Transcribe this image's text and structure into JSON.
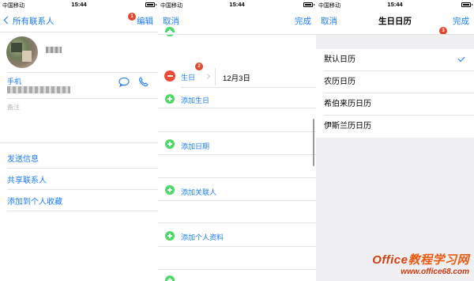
{
  "status_bar": {
    "carrier": "中国移动",
    "time": "15:44"
  },
  "panel1": {
    "nav_back": "所有联系人",
    "nav_edit": "编辑",
    "badge": "1",
    "phone_label": "手机",
    "notes_label": "备注",
    "actions": [
      "发送信息",
      "共享联系人",
      "添加到个人收藏"
    ]
  },
  "panel2": {
    "nav_cancel": "取消",
    "nav_done": "完成",
    "badge": "2",
    "birthday_label": "生日",
    "birthday_value": "12月3日",
    "add_rows": [
      "添加生日",
      "添加日期",
      "添加关联人",
      "添加个人资料"
    ]
  },
  "panel3": {
    "nav_cancel": "取消",
    "nav_title": "生日日历",
    "nav_done": "完成",
    "badge": "3",
    "calendars": [
      {
        "label": "默认日历",
        "selected": true
      },
      {
        "label": "农历日历",
        "selected": false
      },
      {
        "label": "希伯来历日历",
        "selected": false
      },
      {
        "label": "伊斯兰历日历",
        "selected": false
      }
    ]
  },
  "watermark": {
    "line1_prefix": "Office",
    "line1_cn": "教程学习网",
    "line2": "www.office68.com"
  },
  "colors": {
    "accent": "#1a7cf5",
    "badge": "#e2472f",
    "add_green": "#4cd964",
    "remove_red": "#e94b35"
  }
}
